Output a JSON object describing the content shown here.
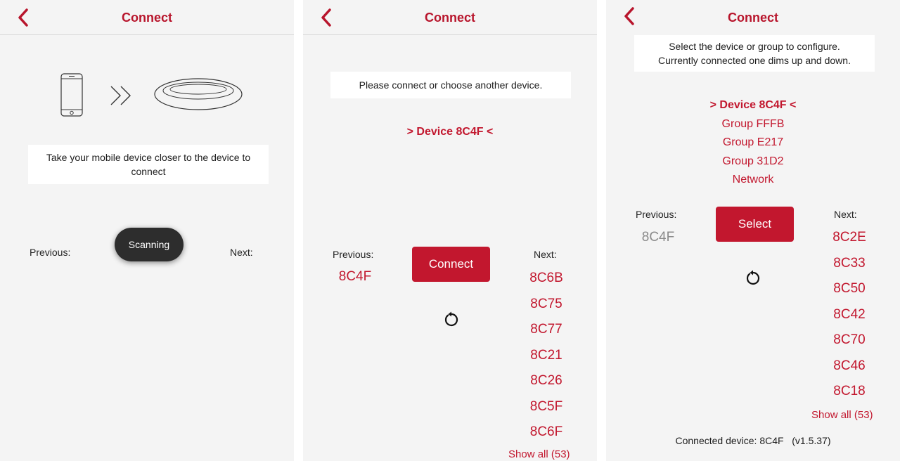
{
  "header": {
    "title": "Connect"
  },
  "screen1": {
    "message": "Take your mobile device closer to the device to connect",
    "previous_label": "Previous:",
    "next_label": "Next:",
    "scanning_label": "Scanning",
    "icons": [
      "phone-icon",
      "double-chevron-right-icon",
      "ceiling-light-icon"
    ]
  },
  "screen2": {
    "message": "Please connect or choose another device.",
    "selected_device": "> Device 8C4F <",
    "previous_label": "Previous:",
    "previous_value": "8C4F",
    "connect_label": "Connect",
    "next_label": "Next:",
    "next_items": [
      "8C6B",
      "8C75",
      "8C77",
      "8C21",
      "8C26",
      "8C5F",
      "8C6F"
    ],
    "show_all": "Show all (53)"
  },
  "screen3": {
    "message_line1": "Select the device or group to configure.",
    "message_line2": "Currently connected one dims up and down.",
    "items": [
      "> Device 8C4F <",
      "Group FFFB",
      "Group E217",
      "Group 31D2",
      "Network"
    ],
    "previous_label": "Previous:",
    "previous_value": "8C4F",
    "select_label": "Select",
    "next_label": "Next:",
    "next_items": [
      "8C2E",
      "8C33",
      "8C50",
      "8C42",
      "8C70",
      "8C46",
      "8C18"
    ],
    "show_all": "Show all (53)",
    "connected_device": "Connected device: 8C4F   (v1.5.37)"
  },
  "colors": {
    "accent": "#c2172e",
    "background": "#f4f4f4",
    "dark_pill": "#2d2d2d"
  }
}
